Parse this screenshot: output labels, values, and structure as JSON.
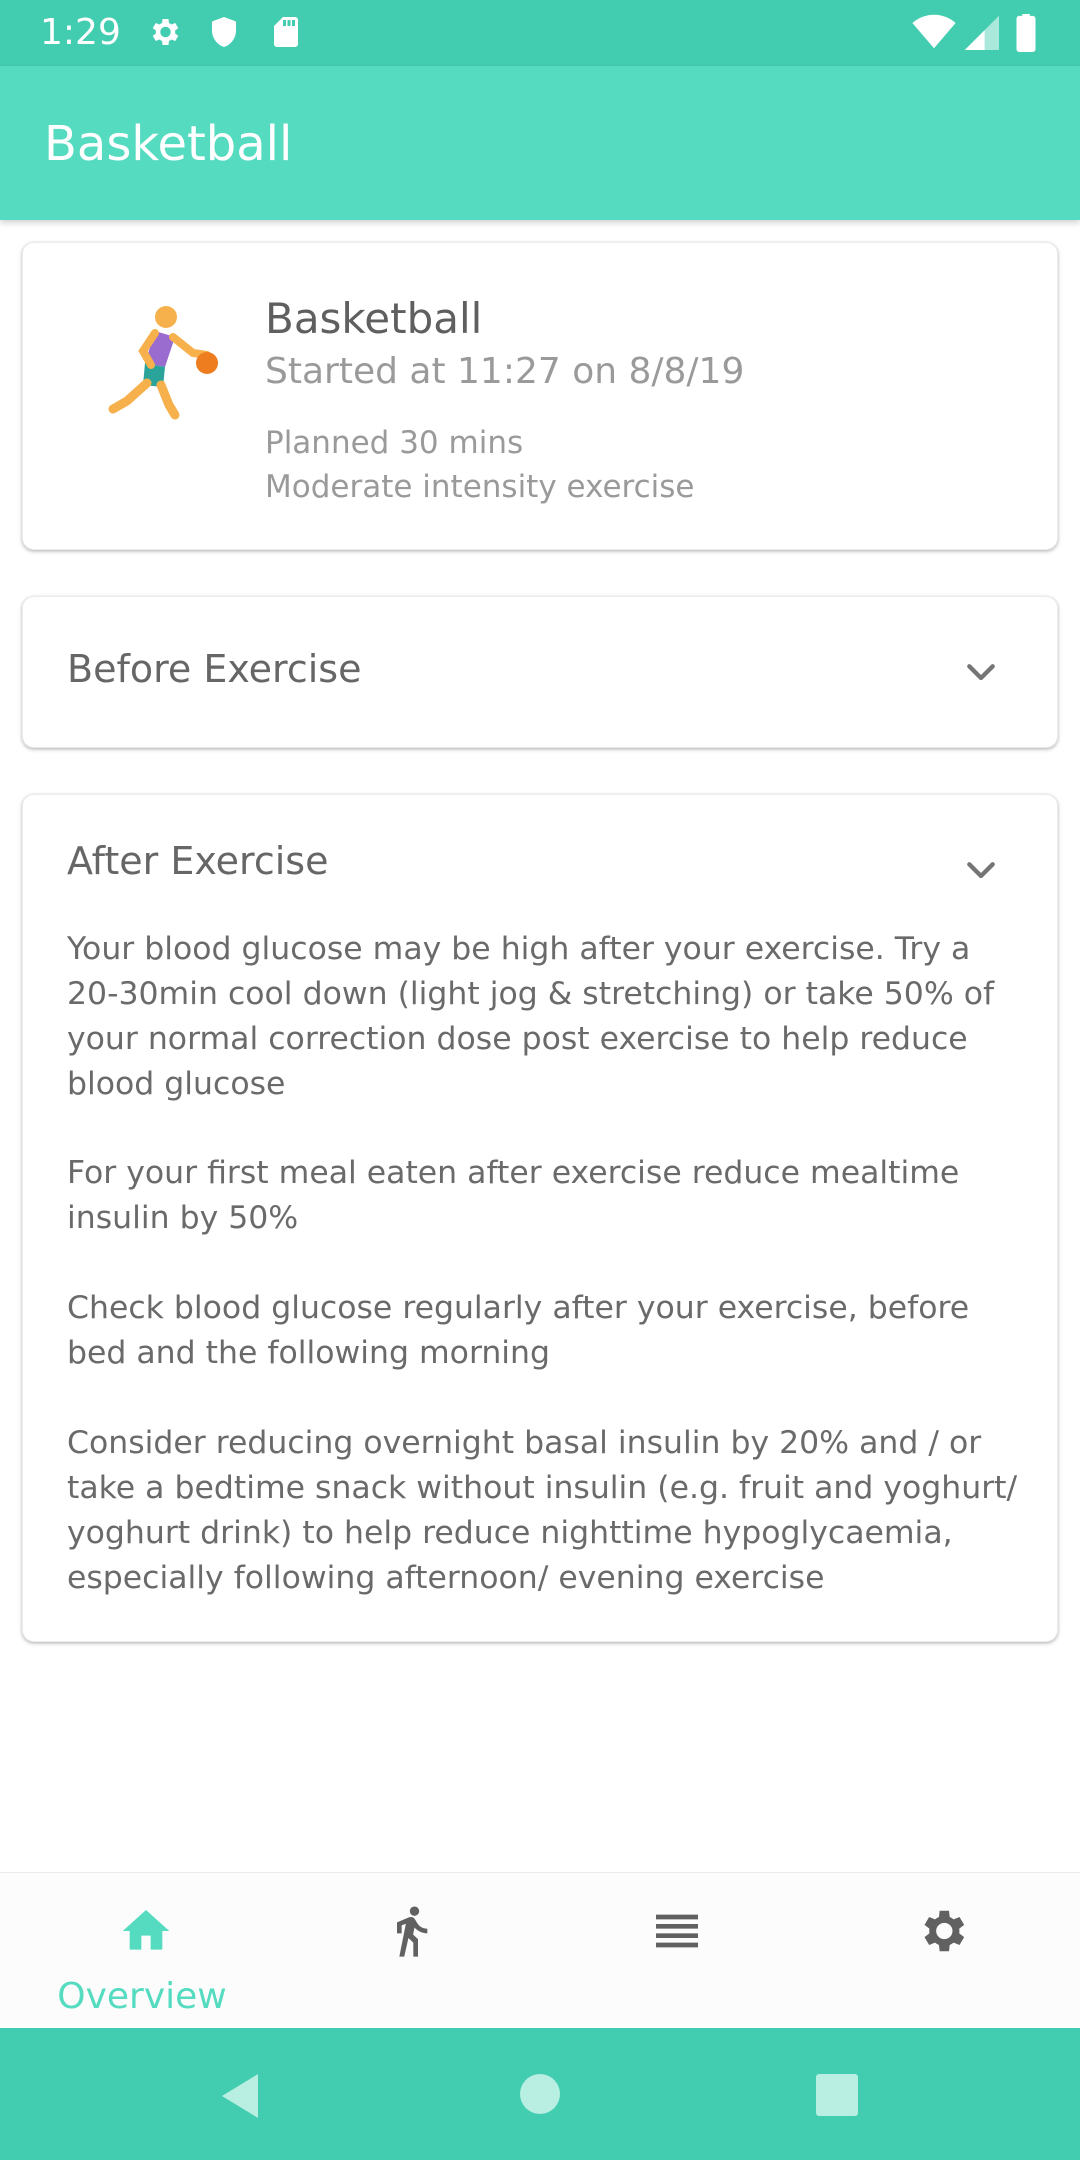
{
  "status_bar": {
    "time": "1:29",
    "left_icons": [
      "gear-icon",
      "shield-icon",
      "sd-card-icon"
    ],
    "right_icons": [
      "wifi-icon",
      "signal-icon",
      "battery-icon"
    ]
  },
  "app_bar": {
    "title": "Basketball"
  },
  "summary": {
    "icon": "basketball-player-icon",
    "name": "Basketball",
    "started": "Started at 11:27 on 8/8/19",
    "planned": "Planned 30 mins",
    "intensity": "Moderate intensity exercise"
  },
  "before_exercise": {
    "title": "Before Exercise"
  },
  "after_exercise": {
    "title": "After Exercise",
    "paragraphs": [
      "Your blood glucose may be high after your exercise. Try a 20-30min cool down (light jog & stretching) or take 50% of your normal correction dose post exercise to help reduce blood glucose",
      "For your first meal eaten after exercise reduce  mealtime insulin by 50%",
      "Check blood glucose regularly after your exercise, before bed and the following morning",
      "Consider reducing overnight basal insulin by 20% and / or take a bedtime snack without insulin (e.g. fruit and yoghurt/ yoghurt drink) to help reduce nighttime hypoglycaemia, especially  following afternoon/ evening exercise"
    ]
  },
  "bottom_nav": {
    "items": [
      {
        "icon": "home-icon",
        "label": "Overview",
        "active": true
      },
      {
        "icon": "running-icon",
        "label": "",
        "active": false
      },
      {
        "icon": "list-icon",
        "label": "",
        "active": false
      },
      {
        "icon": "settings-icon",
        "label": "",
        "active": false
      }
    ]
  },
  "system_nav": [
    "back-icon",
    "home-circle-icon",
    "recents-icon"
  ],
  "colors": {
    "accent": "#54dbc0",
    "status_bar": "#43cdb0",
    "text_primary": "#616161",
    "text_secondary": "#9a9a9a"
  }
}
